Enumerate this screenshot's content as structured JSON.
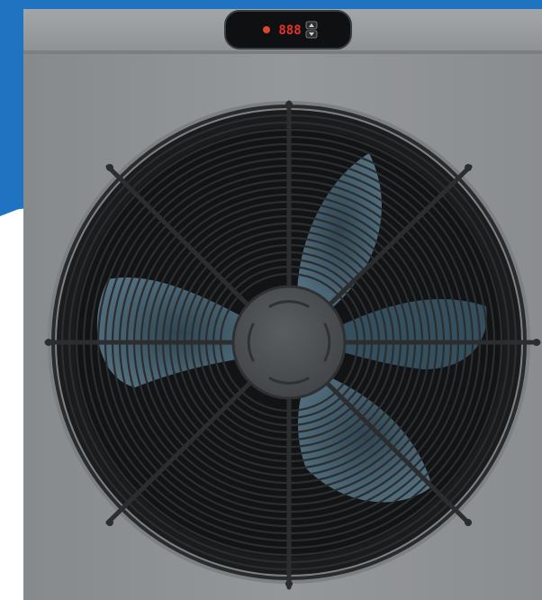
{
  "product": {
    "display_readout": "888",
    "display_color": "#e8302a",
    "accent_blue": "#1f73c1",
    "panel_grey": "#8f9294",
    "top_grey": "#9c9fa1",
    "blade_color": "#3f5866",
    "grille_color": "#2b2d2f",
    "hub_color": "#4a4d50"
  }
}
